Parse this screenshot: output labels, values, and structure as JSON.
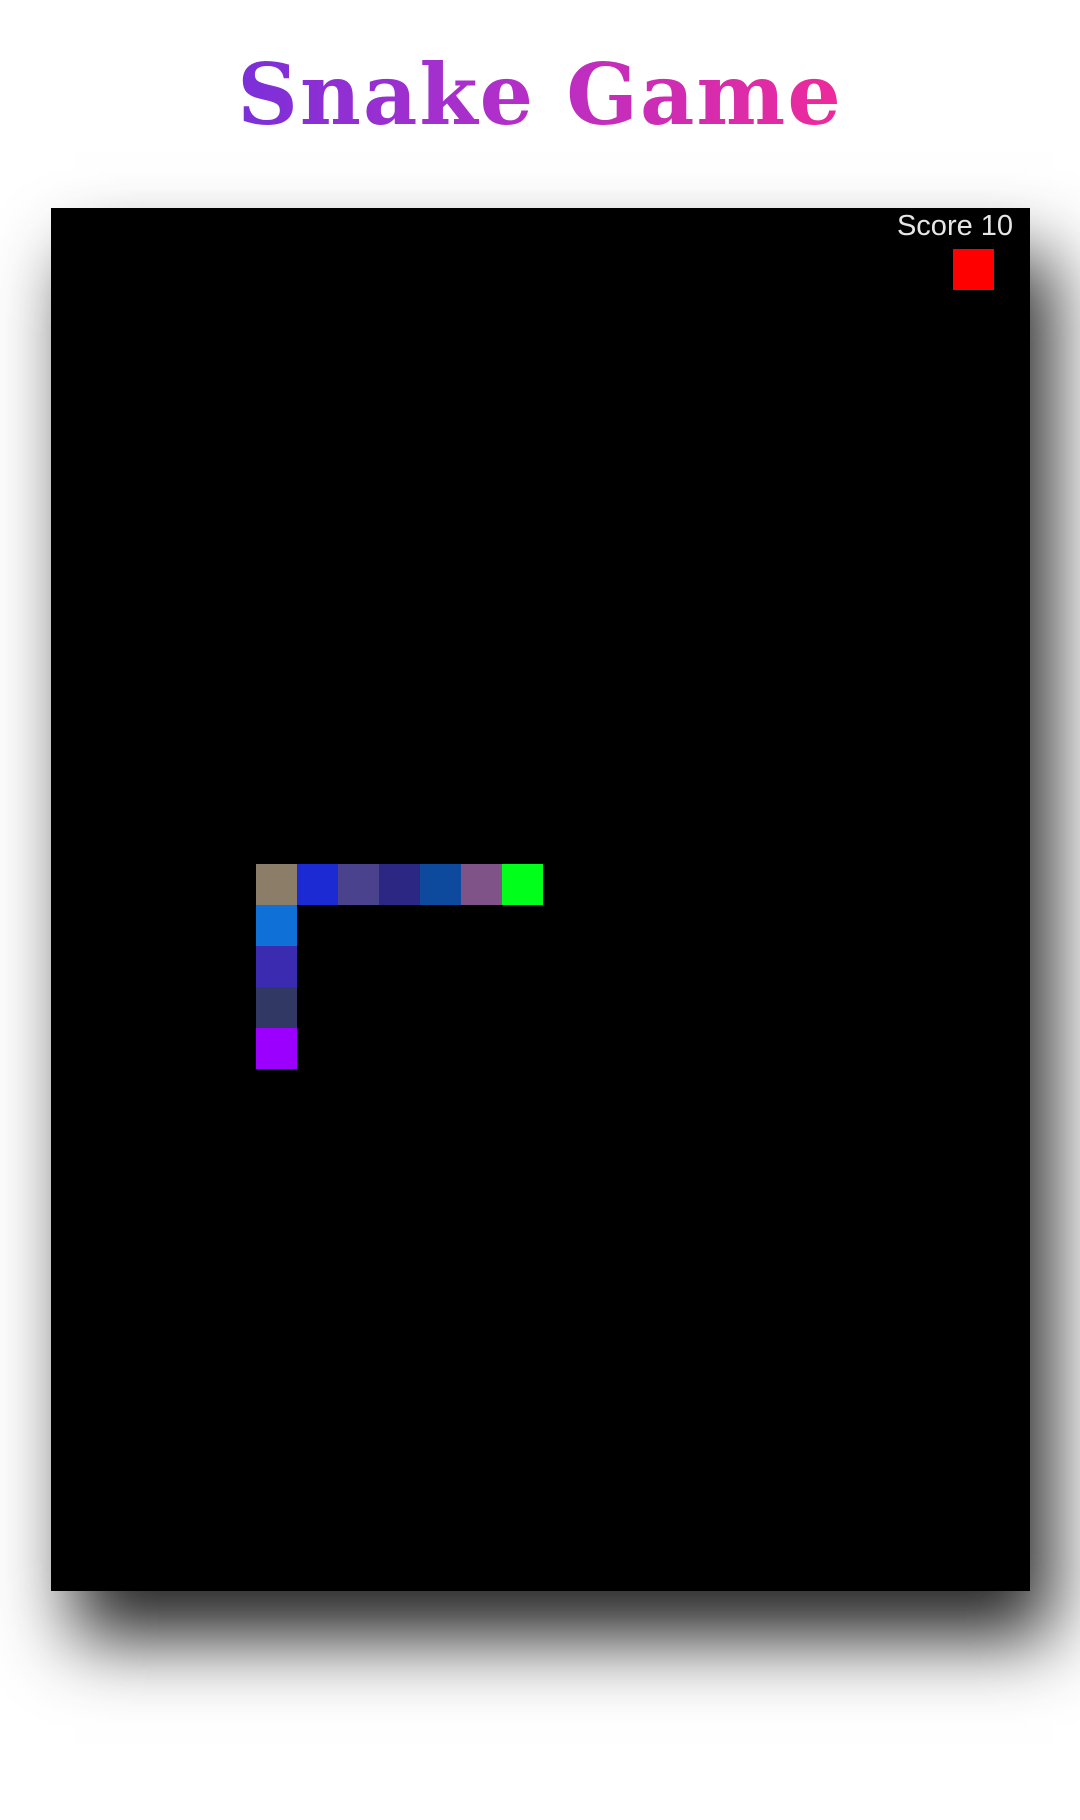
{
  "title": "Snake Game",
  "score": {
    "label": "Score",
    "value": "10"
  },
  "food": {
    "col": 22,
    "row": 1,
    "color": "#ff0000"
  },
  "snake": {
    "segments": [
      {
        "col": 11,
        "row": 16,
        "color": "#00ff1a",
        "head": true
      },
      {
        "col": 10,
        "row": 16,
        "color": "#7f5387"
      },
      {
        "col": 9,
        "row": 16,
        "color": "#0d4a9e"
      },
      {
        "col": 8,
        "row": 16,
        "color": "#2c2782"
      },
      {
        "col": 7,
        "row": 16,
        "color": "#4a428d"
      },
      {
        "col": 6,
        "row": 16,
        "color": "#1b2ad2"
      },
      {
        "col": 5,
        "row": 16,
        "color": "#8c7d68"
      },
      {
        "col": 5,
        "row": 17,
        "color": "#0f70d8"
      },
      {
        "col": 5,
        "row": 18,
        "color": "#3b2bb0"
      },
      {
        "col": 5,
        "row": 19,
        "color": "#313864"
      },
      {
        "col": 5,
        "row": 20,
        "color": "#9b00ff"
      }
    ]
  },
  "colors": {
    "board_background": "#000000",
    "title_gradient_start": "#7b2fd9",
    "title_gradient_end": "#ee2a9a"
  }
}
